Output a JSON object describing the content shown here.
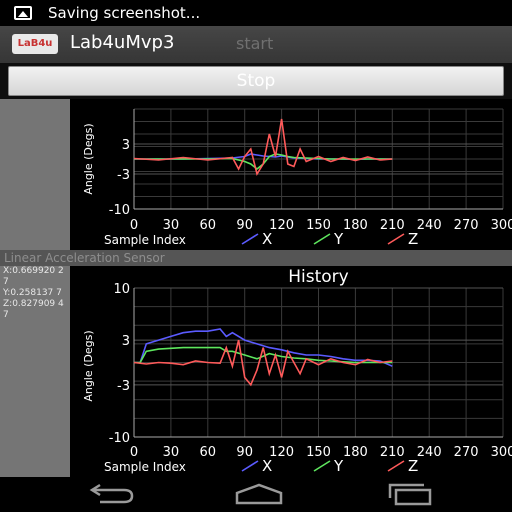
{
  "status_bar": {
    "text": "Saving screenshot..."
  },
  "action_bar": {
    "logo_text": "LaB4u",
    "title": "Lab4uMvp3",
    "start_label": "start"
  },
  "stop_button": {
    "label": "Stop"
  },
  "sensor": {
    "title": "Linear Acceleration Sensor",
    "x_readout": "X:0.669920 27",
    "y_readout": "Y:0.258137 7",
    "z_readout": "Z:0.827909 47"
  },
  "colors": {
    "x": "#5b5bff",
    "y": "#5ee65e",
    "z": "#ff5a5a"
  },
  "chart_data": [
    {
      "type": "line",
      "title": "",
      "xlabel": "Sample Index",
      "ylabel": "Angle (Degs)",
      "xlim": [
        0,
        300
      ],
      "ylim": [
        -10,
        10
      ],
      "x_ticks": [
        "0",
        "30",
        "60",
        "90",
        "120",
        "150",
        "180",
        "210",
        "240",
        "270",
        "300"
      ],
      "y_ticks": [
        "3",
        "-3",
        "-10"
      ],
      "legend": "bottom",
      "grid": true,
      "series": [
        {
          "name": "X",
          "x": [
            0,
            20,
            40,
            60,
            80,
            90,
            95,
            100,
            105,
            110,
            115,
            120,
            125,
            130,
            140,
            150,
            160,
            170,
            180,
            190,
            200,
            210
          ],
          "values": [
            0,
            0,
            0,
            0.1,
            0.2,
            0.5,
            1,
            0.8,
            0.6,
            0.5,
            0.4,
            0.6,
            0.4,
            0.2,
            0.1,
            0,
            0,
            0,
            -0.1,
            0,
            0,
            0
          ]
        },
        {
          "name": "Y",
          "x": [
            0,
            20,
            40,
            60,
            80,
            90,
            95,
            100,
            105,
            110,
            115,
            120,
            125,
            130,
            140,
            150,
            160,
            170,
            180,
            190,
            200,
            210
          ],
          "values": [
            0,
            0,
            0,
            0,
            0.1,
            -0.5,
            -1,
            -2,
            -1,
            0.5,
            1,
            0.8,
            0.5,
            0.3,
            0.2,
            0.1,
            0,
            0,
            0,
            0,
            0,
            0
          ]
        },
        {
          "name": "Z",
          "x": [
            0,
            20,
            40,
            60,
            80,
            85,
            90,
            95,
            100,
            105,
            110,
            115,
            120,
            125,
            130,
            135,
            140,
            150,
            160,
            170,
            180,
            190,
            200,
            210
          ],
          "values": [
            0.1,
            -0.2,
            0.3,
            -0.2,
            0.3,
            -2,
            0.5,
            2,
            -3,
            -1,
            5,
            0.5,
            8,
            -1,
            -1.5,
            2,
            -0.5,
            0.5,
            -0.5,
            0.3,
            -0.3,
            0.4,
            -0.2,
            0
          ]
        }
      ]
    },
    {
      "type": "line",
      "title": "History",
      "xlabel": "Sample Index",
      "ylabel": "Angle (Degs)",
      "xlim": [
        0,
        300
      ],
      "ylim": [
        -10,
        10
      ],
      "x_ticks": [
        "0",
        "30",
        "60",
        "90",
        "120",
        "150",
        "180",
        "210",
        "240",
        "270",
        "300"
      ],
      "y_ticks": [
        "10",
        "3",
        "-3",
        "-10"
      ],
      "legend": "bottom",
      "grid": true,
      "series": [
        {
          "name": "X",
          "x": [
            0,
            5,
            10,
            20,
            30,
            40,
            50,
            60,
            70,
            75,
            80,
            90,
            100,
            110,
            120,
            130,
            140,
            150,
            160,
            170,
            180,
            190,
            200,
            210
          ],
          "values": [
            0,
            0,
            2.5,
            3,
            3.5,
            4,
            4.2,
            4.2,
            4.5,
            3.5,
            4,
            3,
            2.5,
            2,
            1.7,
            1.3,
            1,
            1,
            0.8,
            0.5,
            0.3,
            0.3,
            0.2,
            -0.5
          ]
        },
        {
          "name": "Y",
          "x": [
            0,
            5,
            10,
            20,
            40,
            60,
            70,
            75,
            80,
            90,
            100,
            110,
            120,
            130,
            140,
            150,
            160,
            170,
            180,
            190,
            200,
            210
          ],
          "values": [
            0,
            0,
            1.5,
            1.8,
            2,
            2,
            2,
            1.5,
            1.5,
            1,
            0.5,
            1.2,
            0.8,
            0.6,
            0.5,
            0.3,
            0.2,
            0.1,
            0,
            0,
            0,
            0
          ]
        },
        {
          "name": "Z",
          "x": [
            0,
            10,
            20,
            30,
            40,
            50,
            60,
            70,
            75,
            80,
            85,
            90,
            95,
            100,
            105,
            110,
            115,
            120,
            125,
            130,
            135,
            140,
            150,
            160,
            170,
            180,
            190,
            200,
            210
          ],
          "values": [
            0,
            -0.2,
            0,
            -0.1,
            -0.3,
            0.2,
            0,
            -0.1,
            2,
            -0.5,
            3,
            -2,
            -3,
            -1,
            2,
            -1.5,
            1,
            -2,
            1.5,
            0,
            -1.5,
            0.5,
            -0.3,
            0.5,
            0,
            -0.3,
            0.4,
            0,
            0.2
          ]
        }
      ]
    }
  ],
  "nav": {
    "back": "back-icon",
    "home": "home-icon",
    "recents": "recents-icon"
  }
}
